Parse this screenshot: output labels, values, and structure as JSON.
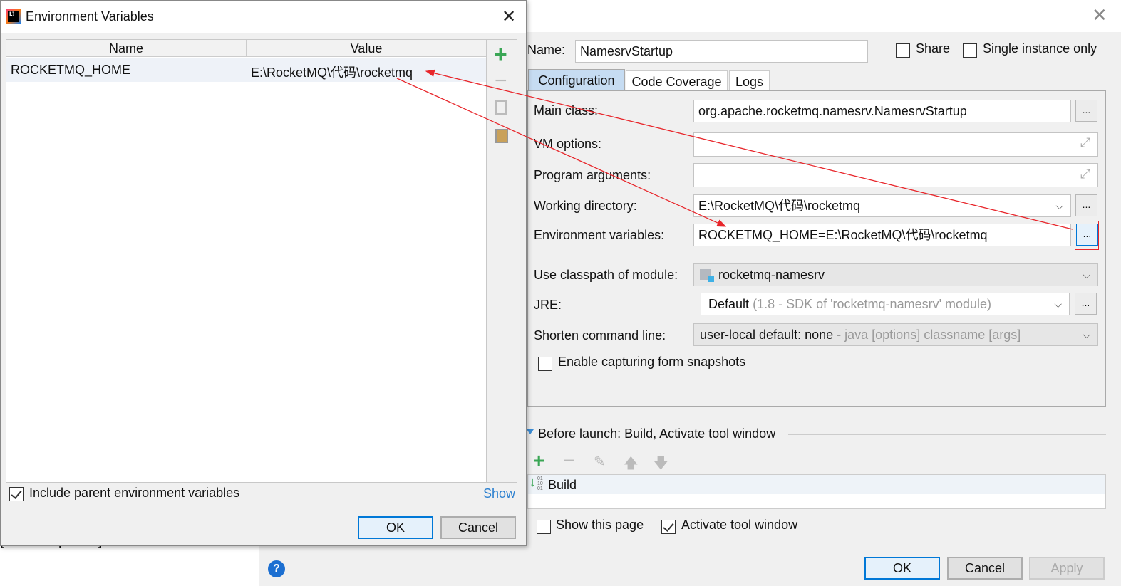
{
  "background": {
    "partial_text": "[rocketmq-store]"
  },
  "run_config": {
    "name_label": "Name:",
    "name_value": "NamesrvStartup",
    "share_label": "Share",
    "single_instance_label": "Single instance only",
    "tabs": [
      {
        "label": "Configuration",
        "active": true
      },
      {
        "label": "Code Coverage"
      },
      {
        "label": "Logs"
      }
    ],
    "fields": {
      "main_class": {
        "label": "Main class:",
        "value": "org.apache.rocketmq.namesrv.NamesrvStartup"
      },
      "vm_options": {
        "label": "VM options:",
        "value": ""
      },
      "program_arguments": {
        "label": "Program arguments:",
        "value": ""
      },
      "working_directory": {
        "label": "Working directory:",
        "value": "E:\\RocketMQ\\代码\\rocketmq"
      },
      "environment_variables": {
        "label": "Environment variables:",
        "value": "ROCKETMQ_HOME=E:\\RocketMQ\\代码\\rocketmq"
      },
      "classpath_module": {
        "label": "Use classpath of module:",
        "value": "rocketmq-namesrv"
      },
      "jre": {
        "label": "JRE:",
        "value": "Default",
        "hint": "(1.8 - SDK of 'rocketmq-namesrv' module)"
      },
      "shorten_command_line": {
        "label": "Shorten command line:",
        "value": "user-local default: none",
        "hint": "- java [options] classname [args]"
      }
    },
    "enable_snapshots_label": "Enable capturing form snapshots",
    "before_launch_label": "Before launch: Build, Activate tool window",
    "before_launch_items": [
      "Build"
    ],
    "show_page_label": "Show this page",
    "activate_tool_window_label": "Activate tool window",
    "ok": "OK",
    "cancel": "Cancel",
    "apply": "Apply",
    "browse": "..."
  },
  "env_dialog": {
    "title": "Environment Variables",
    "columns": [
      "Name",
      "Value"
    ],
    "rows": [
      {
        "name": "ROCKETMQ_HOME",
        "value": "E:\\RocketMQ\\代码\\rocketmq"
      }
    ],
    "include_parent_label": "Include parent environment variables",
    "include_parent_checked": true,
    "show_link": "Show",
    "ok": "OK",
    "cancel": "Cancel"
  },
  "colors": {
    "accent": "#0078d7",
    "annotation": "#e8262b",
    "add": "#3aa655"
  }
}
